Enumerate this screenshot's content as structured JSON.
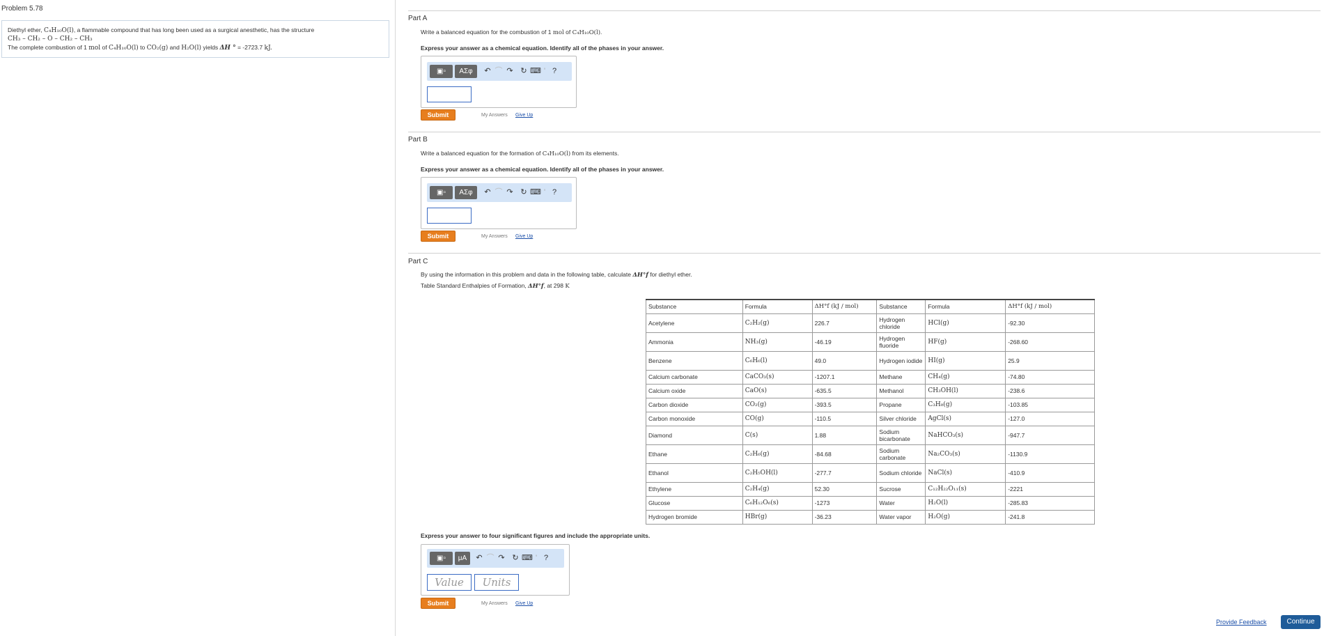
{
  "problem": {
    "title": "Problem 5.78",
    "line1_prefix": "Diethyl ether,",
    "line1_formula": "C₄H₁₀O(l)",
    "line1_suffix": ", a flammable compound that has long been used as a surgical anesthetic, has the structure",
    "structure": "CH₃ – CH₂ – O – CH₂ – CH₃",
    "line3_prefix": "The complete combustion of 1",
    "line3_unit": "mol",
    "line3_of": "of",
    "line3_formula": "C₄H₁₀O(l)",
    "line3_to": "to",
    "line3_product1": "CO₂(g)",
    "line3_and": "and",
    "line3_product2": "H₂O(l)",
    "line3_yields": "yields",
    "line3_dh": "ΔH °",
    "line3_value": "= -2723.7",
    "line3_kj": "kJ."
  },
  "partA": {
    "title": "Part A",
    "question_prefix": "Write a balanced equation for the combustion of 1",
    "question_unit": "mol",
    "question_of": "of",
    "question_formula": "C₄H₁₀O(l)",
    "question_end": ".",
    "instruction": "Express your answer as a chemical equation. Identify all of the phases in your answer.",
    "greek_label": "ΑΣφ",
    "help_label": "?",
    "submit_label": "Submit",
    "my_answers_label": "My Answers",
    "give_up_label": "Give Up"
  },
  "partB": {
    "title": "Part B",
    "question_prefix": "Write a balanced equation for the formation of",
    "question_formula": "C₄H₁₀O(l)",
    "question_suffix": "from its elements.",
    "instruction": "Express your answer as a chemical equation. Identify all of the phases in your answer.",
    "greek_label": "ΑΣφ",
    "help_label": "?",
    "submit_label": "Submit",
    "my_answers_label": "My Answers",
    "give_up_label": "Give Up"
  },
  "partC": {
    "title": "Part C",
    "question_prefix": "By using the information in this problem and data in the following table, calculate",
    "question_symbol": "ΔH°f",
    "question_suffix": "for diethyl ether.",
    "table_caption_prefix": "Table Standard Enthalpies of Formation,",
    "table_caption_symbol": "ΔH°f",
    "table_caption_mid": ", at 298",
    "table_caption_unit": "K",
    "instruction": "Express your answer to four significant figures and include the appropriate units.",
    "units_label": "μA",
    "help_label": "?",
    "value_placeholder": "Value",
    "units_placeholder": "Units",
    "submit_label": "Submit",
    "my_answers_label": "My Answers",
    "give_up_label": "Give Up"
  },
  "table": {
    "headers": [
      "Substance",
      "Formula",
      "ΔH°f (kJ / mol)",
      "Substance",
      "Formula",
      "ΔH°f (kJ / mol)"
    ],
    "rows": [
      [
        "Acetylene",
        "C₂H₂(g)",
        "226.7",
        "Hydrogen chloride",
        "HCl(g)",
        "-92.30"
      ],
      [
        "Ammonia",
        "NH₃(g)",
        "-46.19",
        "Hydrogen fluoride",
        "HF(g)",
        "-268.60"
      ],
      [
        "Benzene",
        "C₆H₆(l)",
        "49.0",
        "Hydrogen iodide",
        "HI(g)",
        "25.9"
      ],
      [
        "Calcium carbonate",
        "CaCO₃(s)",
        "-1207.1",
        "Methane",
        "CH₄(g)",
        "-74.80"
      ],
      [
        "Calcium oxide",
        "CaO(s)",
        "-635.5",
        "Methanol",
        "CH₃OH(l)",
        "-238.6"
      ],
      [
        "Carbon dioxide",
        "CO₂(g)",
        "-393.5",
        "Propane",
        "C₃H₈(g)",
        "-103.85"
      ],
      [
        "Carbon monoxide",
        "CO(g)",
        "-110.5",
        "Silver chloride",
        "AgCl(s)",
        "-127.0"
      ],
      [
        "Diamond",
        "C(s)",
        "1.88",
        "Sodium bicarbonate",
        "NaHCO₃(s)",
        "-947.7"
      ],
      [
        "Ethane",
        "C₂H₆(g)",
        "-84.68",
        "Sodium carbonate",
        "Na₂CO₃(s)",
        "-1130.9"
      ],
      [
        "Ethanol",
        "C₂H₅OH(l)",
        "-277.7",
        "Sodium chloride",
        "NaCl(s)",
        "-410.9"
      ],
      [
        "Ethylene",
        "C₂H₄(g)",
        "52.30",
        "Sucrose",
        "C₁₂H₂₂O₁₁(s)",
        "-2221"
      ],
      [
        "Glucose",
        "C₆H₁₂O₆(s)",
        "-1273",
        "Water",
        "H₂O(l)",
        "-285.83"
      ],
      [
        "Hydrogen bromide",
        "HBr(g)",
        "-36.23",
        "Water vapor",
        "H₂O(g)",
        "-241.8"
      ]
    ]
  },
  "footer": {
    "provide_feedback": "Provide Feedback",
    "continue": "Continue"
  }
}
